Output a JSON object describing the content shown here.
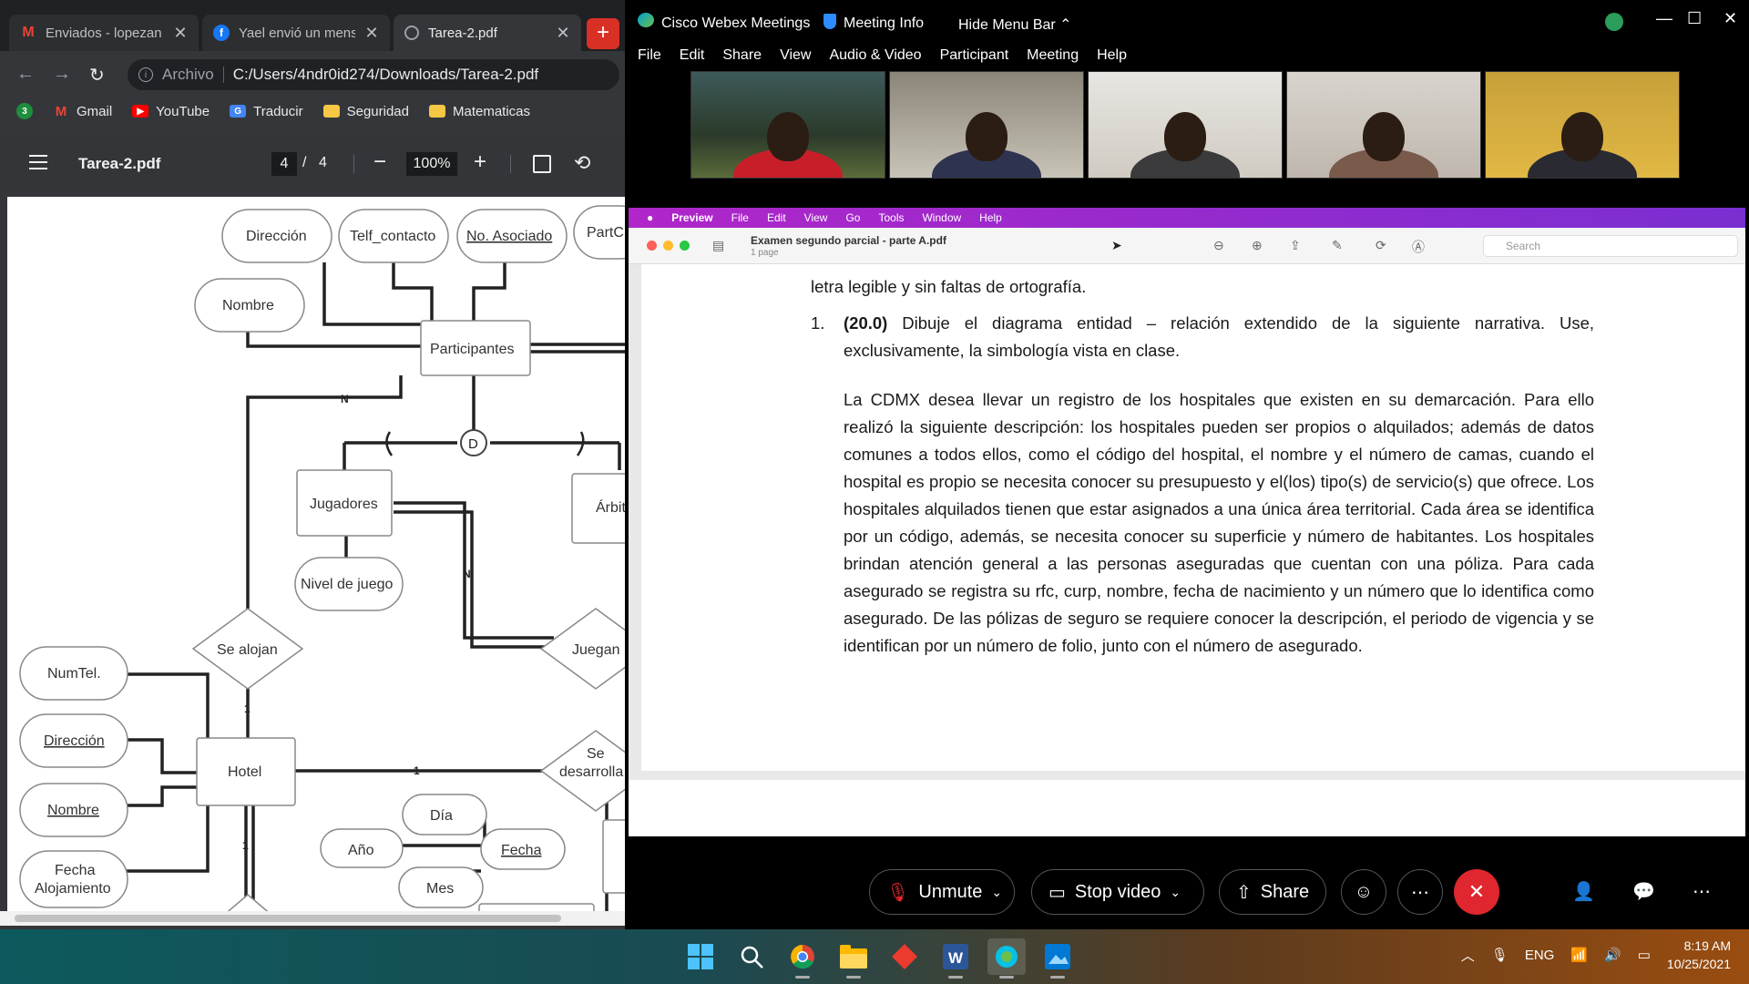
{
  "chrome": {
    "tabs": [
      {
        "title": "Enviados - lopezan",
        "favicon": "gmail-icon",
        "color": "#ea4335"
      },
      {
        "title": "Yael envió un mens",
        "favicon": "facebook-icon",
        "color": "#1877f2"
      },
      {
        "title": "Tarea-2.pdf",
        "favicon": "globe-icon",
        "color": "#9aa0a6"
      }
    ],
    "address": {
      "scheme": "Archivo",
      "path": "C:/Users/4ndr0id274/Downloads/Tarea-2.pdf"
    },
    "bookmarks": [
      {
        "label": "Gmail",
        "icon": "gmail-icon"
      },
      {
        "label": "YouTube",
        "icon": "youtube-icon"
      },
      {
        "label": "Traducir",
        "icon": "translate-icon"
      },
      {
        "label": "Seguridad",
        "icon": "folder-icon"
      },
      {
        "label": "Matematicas",
        "icon": "folder-icon"
      }
    ],
    "extension_badge": "3",
    "pdf": {
      "title": "Tarea-2.pdf",
      "page": "4",
      "sep": "/",
      "total": "4",
      "zoom": "100%"
    }
  },
  "diagram": {
    "attributes": {
      "direccion_top": "Dirección",
      "telf": "Telf_contacto",
      "no_asociado": "No. Asociado",
      "partc": "PartC",
      "nombre_top": "Nombre",
      "nivel": "Nivel de juego",
      "numtel": "NumTel.",
      "direccion": "Dirección",
      "nombre": "Nombre",
      "fecha_aloj_1": "Fecha",
      "fecha_aloj_2": "Alojamiento",
      "dia": "Día",
      "anio": "Año",
      "mes": "Mes",
      "fecha": "Fecha"
    },
    "entities": {
      "participantes": "Participantes",
      "jugadores": "Jugadores",
      "arbitros": "Árbit",
      "hotel": "Hotel"
    },
    "relations": {
      "se_alojan": "Se alojan",
      "juegan": "Juegan",
      "se_desarrolla_1": "Se",
      "se_desarrolla_2": "desarrolla"
    },
    "labels": {
      "n1": "N",
      "n2": "N",
      "one_a": "1",
      "one_b": "1",
      "one_c": "1",
      "disjoint": "D"
    }
  },
  "webex": {
    "app_name": "Cisco Webex Meetings",
    "meeting_info": "Meeting Info",
    "hide_menu": "Hide Menu Bar",
    "menu": [
      "File",
      "Edit",
      "Share",
      "View",
      "Audio & Video",
      "Participant",
      "Meeting",
      "Help"
    ],
    "controls": {
      "unmute": "Unmute",
      "stop_video": "Stop video",
      "share": "Share"
    }
  },
  "preview": {
    "menubar": [
      "Preview",
      "File",
      "Edit",
      "View",
      "Go",
      "Tools",
      "Window",
      "Help"
    ],
    "doc_name": "Examen segundo parcial - parte  A.pdf",
    "pages": "1 page",
    "search_placeholder": "Search",
    "line0": "letra legible y sin faltas de ortografía.",
    "item_num": "1.",
    "item_points": "(20.0)",
    "item_text": " Dibuje el diagrama entidad – relación extendido de la siguiente narrativa. Use, exclusivamente, la simbología vista en clase.",
    "narrative": "La CDMX desea llevar un registro de los hospitales que existen en su demarcación. Para ello realizó la siguiente descripción: los hospitales pueden ser propios o alquilados; además de datos comunes a todos ellos, como el código del hospital, el nombre y el número de camas, cuando el hospital es propio se necesita conocer su presupuesto y el(los) tipo(s) de servicio(s) que ofrece. Los hospitales alquilados tienen que estar asignados a una única área territorial. Cada área se identifica por un código, además, se necesita conocer su superficie y número de habitantes. Los hospitales brindan atención general a las personas aseguradas que cuentan con una póliza. Para cada asegurado se registra su rfc, curp, nombre, fecha de nacimiento y un número que lo identifica como asegurado. De las pólizas de seguro se requiere conocer la descripción, el periodo de vigencia y se identifican por un número de folio, junto con el número de asegurado."
  },
  "taskbar": {
    "lang": "ENG",
    "time": "8:19 AM",
    "date": "10/25/2021"
  }
}
